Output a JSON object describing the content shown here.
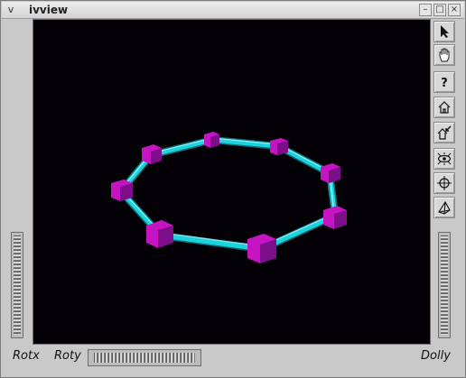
{
  "window": {
    "title": "ivview",
    "menu_glyph": "v",
    "minimize_glyph": "–",
    "maximize_glyph": "□",
    "close_glyph": "×"
  },
  "toolbar": {
    "tools": [
      {
        "name": "pick-arrow-icon"
      },
      {
        "name": "view-hand-icon"
      },
      {
        "name": "help-icon"
      },
      {
        "name": "home-icon"
      },
      {
        "name": "set-home-icon"
      },
      {
        "name": "view-all-icon"
      },
      {
        "name": "seek-icon"
      },
      {
        "name": "projection-icon"
      }
    ]
  },
  "scene": {
    "background": "#030106",
    "tube_color": "#19d4df",
    "cube_color": "#c614c2",
    "cube_dark": "#7c0e8a"
  },
  "controls": {
    "rotx_label": "Rotx",
    "roty_label": "Roty",
    "dolly_label": "Dolly"
  }
}
